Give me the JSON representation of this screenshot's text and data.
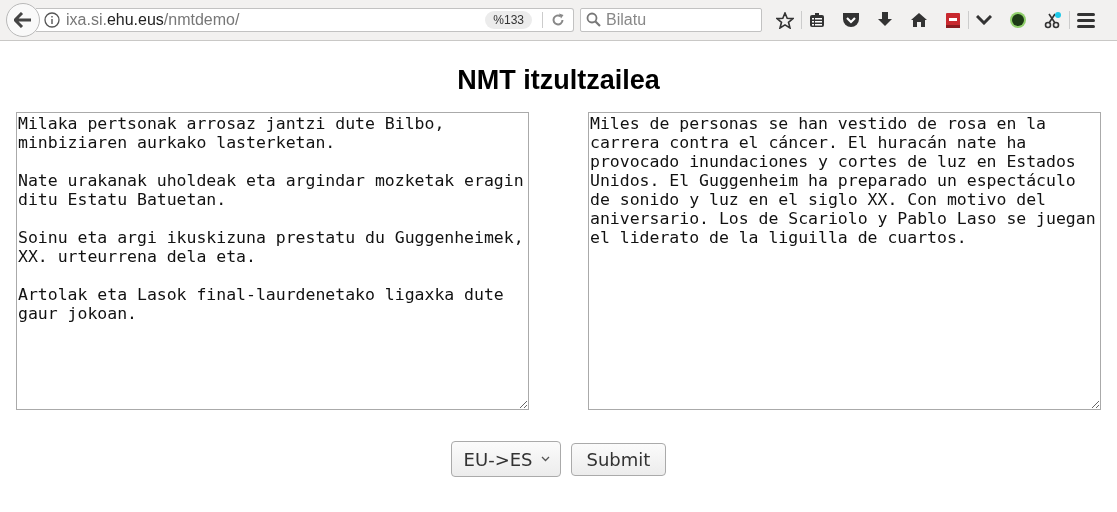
{
  "browser": {
    "url": {
      "host_prefix": "ixa.si.",
      "domain": "ehu.eus",
      "path": "/nmtdemo/"
    },
    "zoom": "%133",
    "search": {
      "placeholder": "Bilatu"
    }
  },
  "page": {
    "title": "NMT itzultzailea",
    "source": {
      "value": "Milaka pertsonak arrosaz jantzi dute Bilbo,\nminbiziaren aurkako lasterketan.\n\nNate urakanak uholdeak eta argindar mozketak eragin\nditu Estatu Batuetan.\n\nSoinu eta argi ikuskizuna prestatu du Guggenheimek,\nXX. urteurrena dela eta.\n\nArtolak eta Lasok final-laurdenetako ligaxka dute\ngaur jokoan."
    },
    "target": {
      "value": "Miles de personas se han vestido de rosa en la carrera contra el cáncer. El huracán nate ha provocado inundaciones y cortes de luz en Estados Unidos. El Guggenheim ha preparado un espectáculo de sonido y luz en el siglo XX. Con motivo del aniversario. Los de Scariolo y Pablo Laso se juegan el liderato de la liguilla de cuartos."
    },
    "direction": "EU->ES",
    "submit": "Submit"
  }
}
